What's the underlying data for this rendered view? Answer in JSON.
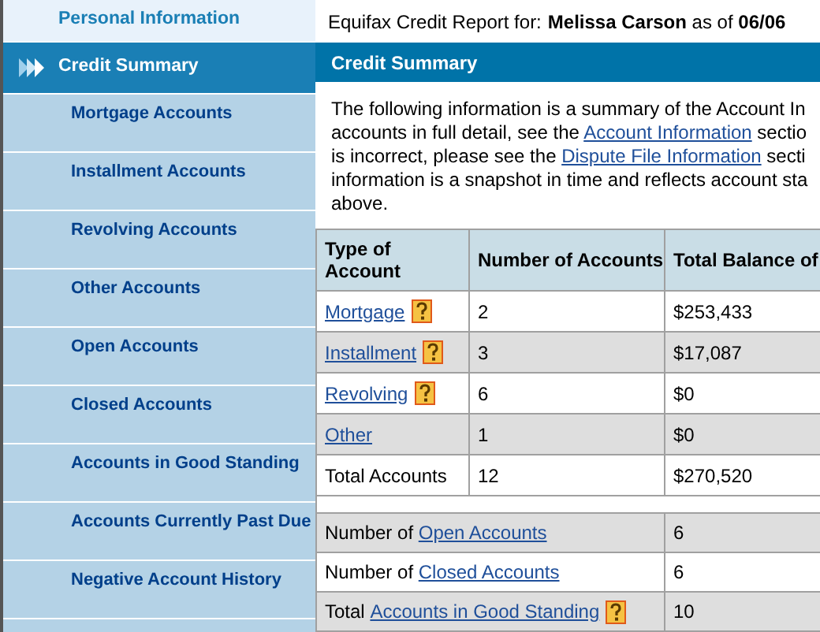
{
  "sidebar": {
    "items": [
      {
        "label": "Personal Information",
        "kind": "top",
        "selected": false
      },
      {
        "label": "Credit Summary",
        "kind": "top",
        "selected": true
      },
      {
        "label": "Mortgage Accounts",
        "kind": "sub",
        "selected": false
      },
      {
        "label": "Installment Accounts",
        "kind": "sub",
        "selected": false
      },
      {
        "label": "Revolving Accounts",
        "kind": "sub",
        "selected": false
      },
      {
        "label": "Other Accounts",
        "kind": "sub",
        "selected": false
      },
      {
        "label": "Open Accounts",
        "kind": "sub",
        "selected": false
      },
      {
        "label": "Closed Accounts",
        "kind": "sub",
        "selected": false
      },
      {
        "label": "Accounts in Good Standing",
        "kind": "sub",
        "selected": false
      },
      {
        "label": "Accounts Currently Past Due",
        "kind": "sub",
        "selected": false
      },
      {
        "label": "Negative Account History",
        "kind": "sub",
        "selected": false
      }
    ]
  },
  "report_title": {
    "prefix": "Equifax Credit Report for:",
    "name": "Melissa Carson",
    "middle": "as of",
    "date": "06/06"
  },
  "section_header": "Credit Summary",
  "intro_lines": [
    [
      {
        "text": "The following information is a summary of the Account In",
        "link": false
      }
    ],
    [
      {
        "text": "accounts in full detail, see the ",
        "link": false
      },
      {
        "text": "Account Information",
        "link": true
      },
      {
        "text": " sectio",
        "link": false
      }
    ],
    [
      {
        "text": "is incorrect, please see the ",
        "link": false
      },
      {
        "text": "Dispute File Information",
        "link": true
      },
      {
        "text": " secti",
        "link": false
      }
    ],
    [
      {
        "text": "information is a snapshot in time and reflects account sta",
        "link": false
      }
    ],
    [
      {
        "text": "above.",
        "link": false
      }
    ]
  ],
  "table": {
    "columns": [
      "Type of Account",
      "Number of Accounts",
      "Total Balance of"
    ],
    "rows": [
      {
        "type": "Mortgage",
        "kind": "link",
        "help": true,
        "count": "2",
        "balance": "$253,433"
      },
      {
        "type": "Installment",
        "kind": "link",
        "help": true,
        "count": "3",
        "balance": "$17,087"
      },
      {
        "type": "Revolving",
        "kind": "link",
        "help": true,
        "count": "6",
        "balance": "$0"
      },
      {
        "type": "Other",
        "kind": "link",
        "help": false,
        "count": "1",
        "balance": "$0"
      },
      {
        "type": "Total Accounts",
        "kind": "text",
        "help": false,
        "count": "12",
        "balance": "$270,520"
      }
    ]
  },
  "totals": [
    {
      "prefix": "Number of",
      "link": "Open Accounts",
      "help": false,
      "value": "6"
    },
    {
      "prefix": "Number of",
      "link": "Closed Accounts",
      "help": false,
      "value": "6"
    },
    {
      "prefix": "Total",
      "link": "Accounts in Good Standing",
      "help": true,
      "value": "10"
    }
  ]
}
